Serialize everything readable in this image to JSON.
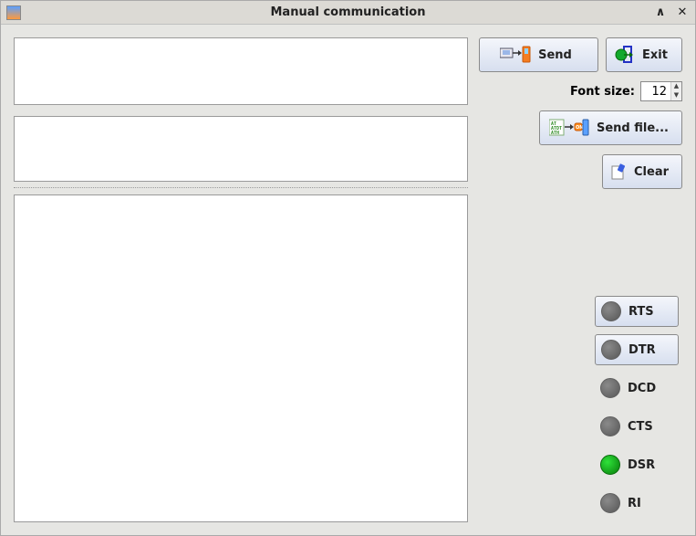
{
  "window": {
    "title": "Manual communication",
    "icon": "app-icon",
    "minimize_glyph": "∧",
    "close_glyph": "✕"
  },
  "buttons": {
    "send": "Send",
    "exit": "Exit",
    "send_file": "Send file...",
    "clear": "Clear"
  },
  "font_size": {
    "label": "Font size:",
    "value": "12"
  },
  "text_areas": {
    "input_top": "",
    "mid": "",
    "main": ""
  },
  "pins": [
    {
      "id": "rts",
      "label": "RTS",
      "toggle": true,
      "on": false
    },
    {
      "id": "dtr",
      "label": "DTR",
      "toggle": true,
      "on": false
    },
    {
      "id": "dcd",
      "label": "DCD",
      "toggle": false,
      "on": false
    },
    {
      "id": "cts",
      "label": "CTS",
      "toggle": false,
      "on": false
    },
    {
      "id": "dsr",
      "label": "DSR",
      "toggle": false,
      "on": true
    },
    {
      "id": "ri",
      "label": "RI",
      "toggle": false,
      "on": false
    }
  ],
  "icons": {
    "send": "computer-to-phone-icon",
    "exit": "green-circle-exit-icon",
    "send_file": "at-script-to-phone-icon",
    "clear": "eraser-icon"
  }
}
